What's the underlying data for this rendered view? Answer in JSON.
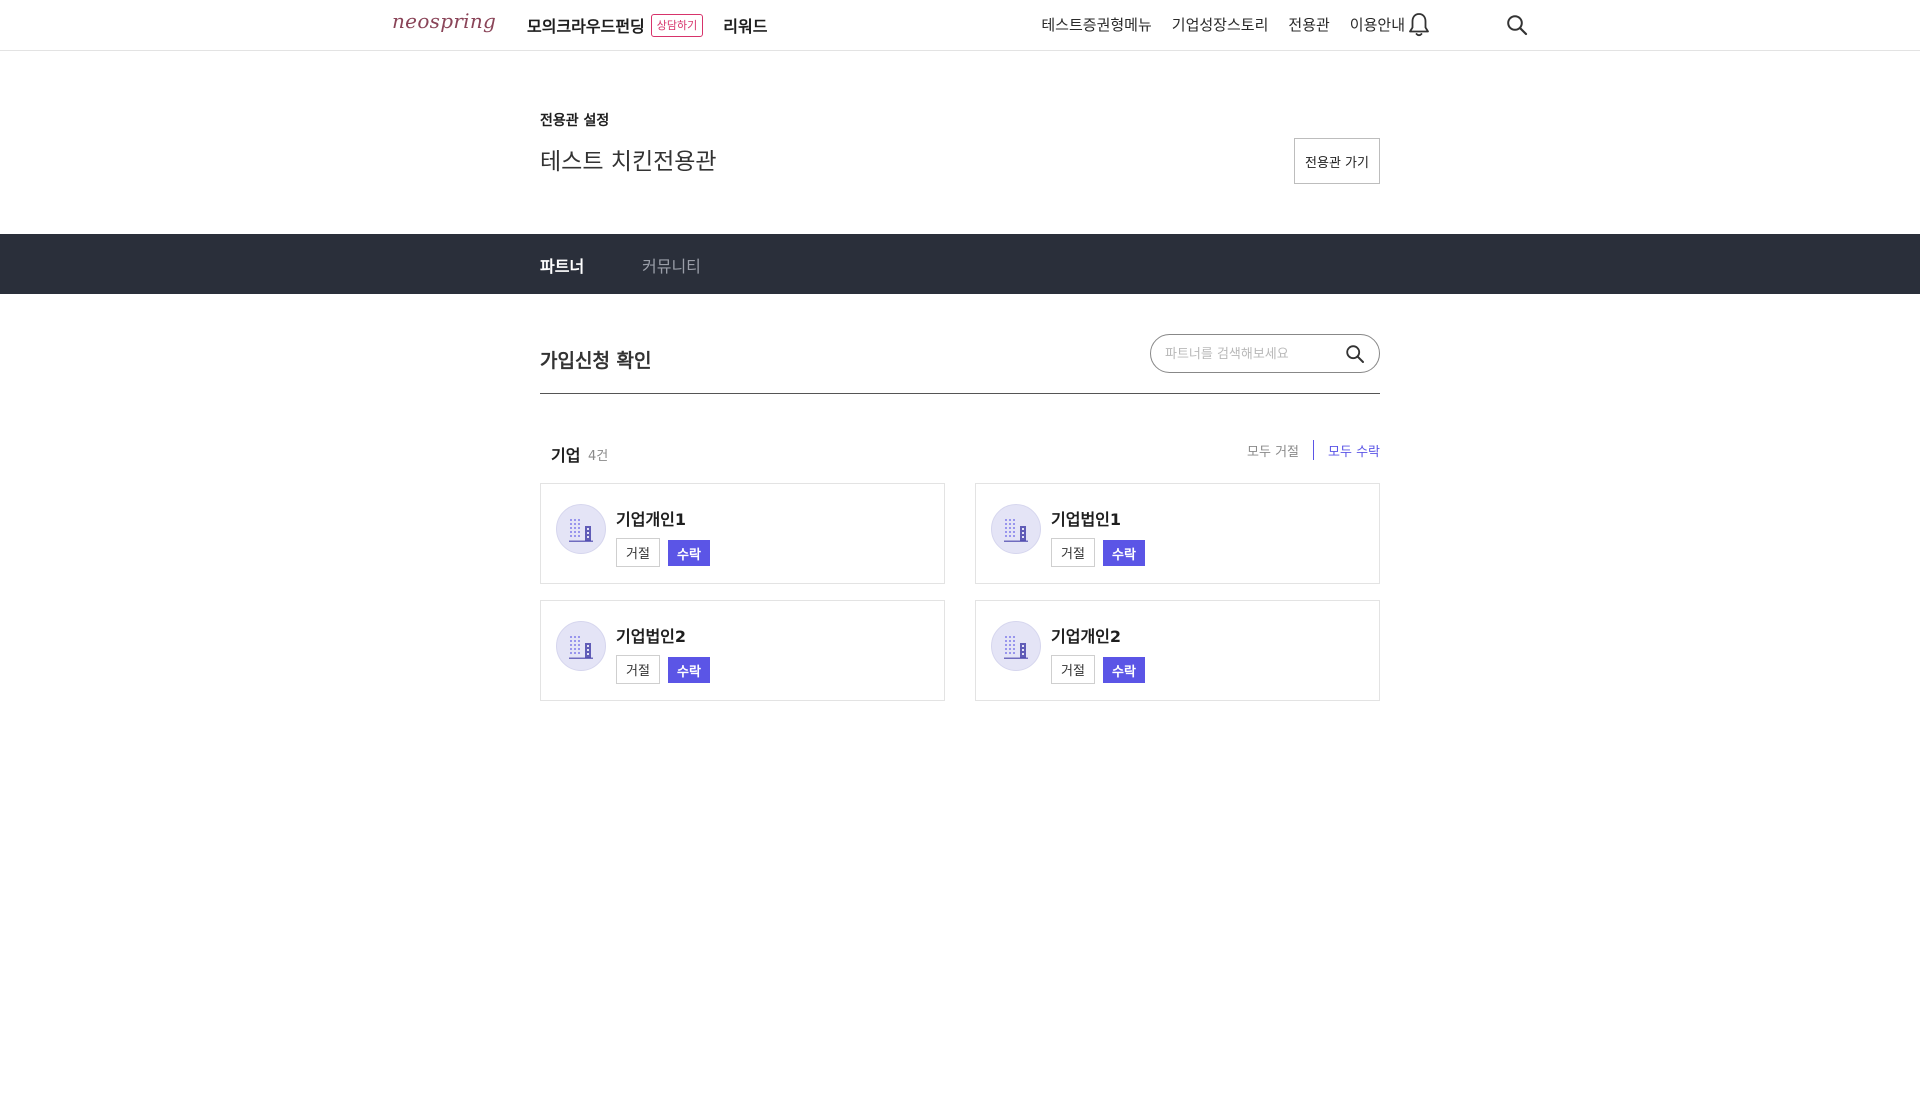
{
  "nav": {
    "logo": "neospring",
    "mock_crowdfunding": "모의크라우드펀딩",
    "consult_badge": "상담하기",
    "rewards": "리워드",
    "right_links": [
      "테스트증권형메뉴",
      "기업성장스토리",
      "전용관",
      "이용안내"
    ],
    "icons": {
      "bell": "bell-icon",
      "search": "search-icon"
    }
  },
  "header": {
    "settings_label": "전용관 설정",
    "title": "테스트 치킨전용관",
    "goto_button": "전용관 가기"
  },
  "tabs": [
    {
      "label": "파트너",
      "active": true
    },
    {
      "label": "커뮤니티",
      "active": false
    }
  ],
  "section": {
    "title": "가입신청 확인",
    "search_placeholder": "파트너를 검색해보세요"
  },
  "company_list": {
    "heading": "기업",
    "count": "4건",
    "reject_all": "모두 거절",
    "accept_all": "모두 수락",
    "items": [
      {
        "name": "기업개인1",
        "reject": "거절",
        "accept": "수락"
      },
      {
        "name": "기업법인1",
        "reject": "거절",
        "accept": "수락"
      },
      {
        "name": "기업법인2",
        "reject": "거절",
        "accept": "수락"
      },
      {
        "name": "기업개인2",
        "reject": "거절",
        "accept": "수락"
      }
    ]
  },
  "colors": {
    "brand_pink": "#d7336b",
    "accent_purple": "#5b55e6",
    "tabbar_bg": "#2a2f3a",
    "avatar_bg": "#e4e4f6"
  }
}
